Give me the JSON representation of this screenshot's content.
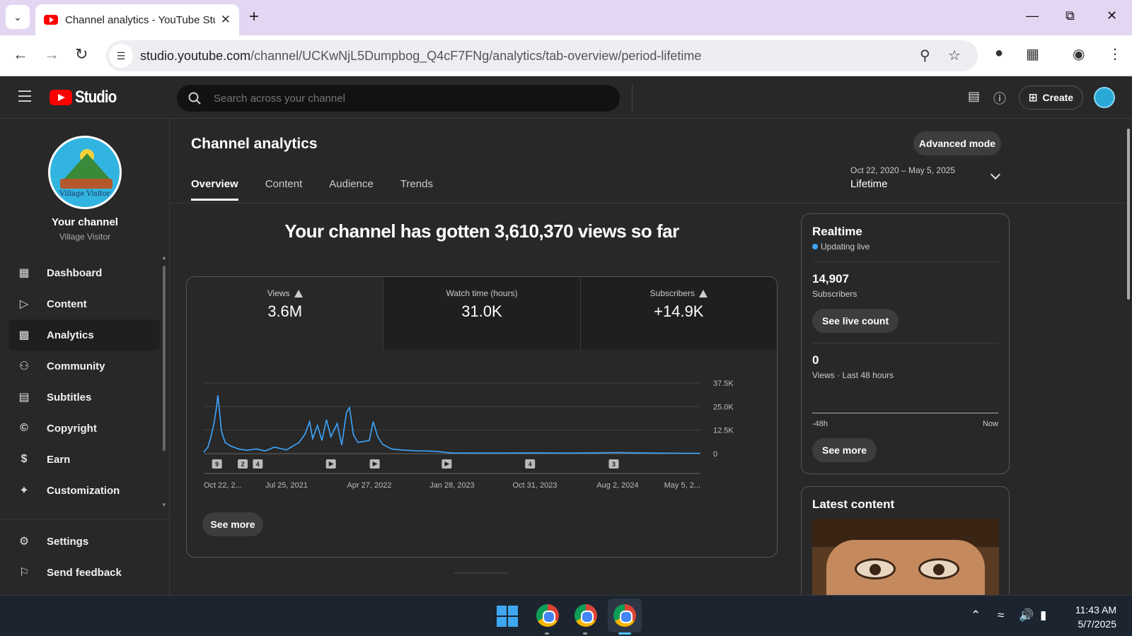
{
  "browser": {
    "tab_title": "Channel analytics - YouTube Studio",
    "url_host": "studio.youtube.com",
    "url_path": "/channel/UCKwNjL5Dumpbog_Q4cF7FNg/analytics/tab-overview/period-lifetime"
  },
  "header": {
    "logo_text": "Studio",
    "search_placeholder": "Search across your channel",
    "create_label": "Create"
  },
  "sidebar": {
    "your_channel": "Your channel",
    "channel_name": "Village Visitor",
    "avatar_caption": "Village Visitor",
    "items": [
      {
        "label": "Dashboard",
        "icon": "dashboard-icon"
      },
      {
        "label": "Content",
        "icon": "content-icon"
      },
      {
        "label": "Analytics",
        "icon": "analytics-icon"
      },
      {
        "label": "Community",
        "icon": "community-icon"
      },
      {
        "label": "Subtitles",
        "icon": "subtitles-icon"
      },
      {
        "label": "Copyright",
        "icon": "copyright-icon"
      },
      {
        "label": "Earn",
        "icon": "earn-icon"
      },
      {
        "label": "Customization",
        "icon": "customization-icon"
      }
    ],
    "bottom_items": [
      {
        "label": "Settings",
        "icon": "gear-icon"
      },
      {
        "label": "Send feedback",
        "icon": "feedback-icon"
      }
    ],
    "active_item": "Analytics"
  },
  "main": {
    "title": "Channel analytics",
    "advanced_mode": "Advanced mode",
    "tabs": [
      "Overview",
      "Content",
      "Audience",
      "Trends"
    ],
    "active_tab": "Overview",
    "period_range": "Oct 22, 2020 – May 5, 2025",
    "period_label": "Lifetime",
    "headline": "Your channel has gotten 3,610,370 views so far",
    "metrics": [
      {
        "label": "Views",
        "value": "3.6M",
        "warning": true
      },
      {
        "label": "Watch time (hours)",
        "value": "31.0K",
        "warning": false
      },
      {
        "label": "Subscribers",
        "value": "+14.9K",
        "warning": true
      }
    ],
    "see_more": "See more"
  },
  "realtime": {
    "title": "Realtime",
    "status": "Updating live",
    "subscribers_value": "14,907",
    "subscribers_label": "Subscribers",
    "see_live_count": "See live count",
    "views_value": "0",
    "views_label": "Views · Last 48 hours",
    "axis_start": "-48h",
    "axis_end": "Now",
    "see_more": "See more"
  },
  "latest": {
    "title": "Latest content"
  },
  "chart_data": {
    "type": "line",
    "series": [
      {
        "values": []
      }
    ],
    "x": [
      "Oct 22, 2...",
      "Jul 25, 2021",
      "Apr 27, 2022",
      "Jan 28, 2023",
      "Oct 31, 2023",
      "Aug 2, 2024",
      "May 5, 2..."
    ],
    "x_dates": [
      "2020-10-22",
      "2021-07-25",
      "2022-04-27",
      "2023-01-28",
      "2023-10-31",
      "2024-08-02",
      "2025-05-05"
    ],
    "y_ticks": [
      "37.5K",
      "25.0K",
      "12.5K",
      "0"
    ],
    "ylim": [
      0,
      37500
    ],
    "daily_views": [
      [
        "2020-10-22",
        800
      ],
      [
        "2020-11-05",
        3500
      ],
      [
        "2020-11-15",
        9000
      ],
      [
        "2020-11-25",
        16000
      ],
      [
        "2020-12-03",
        24000
      ],
      [
        "2020-12-08",
        31000
      ],
      [
        "2020-12-12",
        25000
      ],
      [
        "2020-12-20",
        12000
      ],
      [
        "2021-01-01",
        6000
      ],
      [
        "2021-01-20",
        4000
      ],
      [
        "2021-02-15",
        2500
      ],
      [
        "2021-03-15",
        1800
      ],
      [
        "2021-04-15",
        2500
      ],
      [
        "2021-05-15",
        1500
      ],
      [
        "2021-06-15",
        3500
      ],
      [
        "2021-07-25",
        2000
      ],
      [
        "2021-08-15",
        4000
      ],
      [
        "2021-09-05",
        6000
      ],
      [
        "2021-09-25",
        10500
      ],
      [
        "2021-10-10",
        17000
      ],
      [
        "2021-10-20",
        8000
      ],
      [
        "2021-11-05",
        15000
      ],
      [
        "2021-11-20",
        7000
      ],
      [
        "2021-12-05",
        18000
      ],
      [
        "2021-12-20",
        9000
      ],
      [
        "2022-01-10",
        16000
      ],
      [
        "2022-01-25",
        4500
      ],
      [
        "2022-02-10",
        22000
      ],
      [
        "2022-02-20",
        24500
      ],
      [
        "2022-03-05",
        10000
      ],
      [
        "2022-03-20",
        6000
      ],
      [
        "2022-04-10",
        6500
      ],
      [
        "2022-04-27",
        7000
      ],
      [
        "2022-05-10",
        17000
      ],
      [
        "2022-05-25",
        9000
      ],
      [
        "2022-06-10",
        5000
      ],
      [
        "2022-07-10",
        2500
      ],
      [
        "2022-08-10",
        2000
      ],
      [
        "2022-09-10",
        1700
      ],
      [
        "2022-10-10",
        1500
      ],
      [
        "2022-11-10",
        1400
      ],
      [
        "2022-12-10",
        1200
      ],
      [
        "2023-01-10",
        600
      ],
      [
        "2023-01-28",
        400
      ],
      [
        "2023-06-01",
        300
      ],
      [
        "2023-10-31",
        400
      ],
      [
        "2024-03-01",
        300
      ],
      [
        "2024-08-02",
        600
      ],
      [
        "2024-12-01",
        300
      ],
      [
        "2025-05-05",
        200
      ]
    ],
    "annotations": [
      {
        "date": "2020-12-05",
        "label": "9"
      },
      {
        "date": "2021-03-01",
        "label": "2"
      },
      {
        "date": "2021-04-20",
        "label": "4"
      },
      {
        "date": "2021-12-20",
        "label": "video"
      },
      {
        "date": "2022-05-15",
        "label": "video"
      },
      {
        "date": "2023-01-10",
        "label": "video"
      },
      {
        "date": "2023-10-15",
        "label": "4"
      },
      {
        "date": "2024-07-20",
        "label": "3"
      }
    ],
    "line_color": "#3ea6ff",
    "grid": true
  }
}
